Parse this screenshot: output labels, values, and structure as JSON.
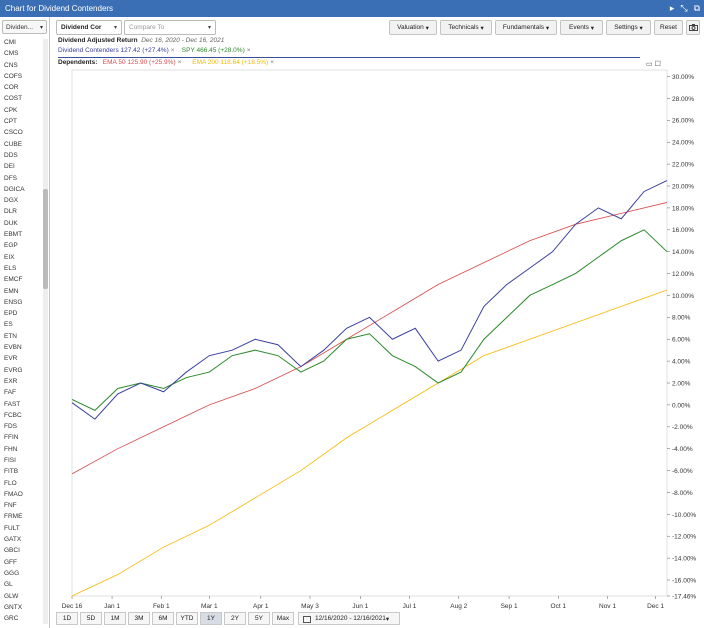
{
  "window": {
    "title": "Chart for Dividend Contenders"
  },
  "sidebar": {
    "select_label": "Dividen...",
    "items": [
      "CMI",
      "CMS",
      "CNS",
      "COFS",
      "COR",
      "COST",
      "CPK",
      "CPT",
      "CSCO",
      "CUBE",
      "DDS",
      "DEI",
      "DFS",
      "DGICA",
      "DGX",
      "DLR",
      "DUK",
      "EBMT",
      "EGP",
      "EIX",
      "ELS",
      "EMCF",
      "EMN",
      "ENSG",
      "EPD",
      "ES",
      "ETN",
      "EVBN",
      "EVR",
      "EVRG",
      "EXR",
      "FAF",
      "FAST",
      "FCBC",
      "FDS",
      "FFIN",
      "FHN",
      "FISI",
      "FITB",
      "FLO",
      "FMAO",
      "FNF",
      "FRME",
      "FULT",
      "GATX",
      "GBCI",
      "GFF",
      "GGG",
      "GL",
      "GLW",
      "GNTX",
      "GRC"
    ]
  },
  "toolbar": {
    "symbol": "Dividend Cor",
    "compare_placeholder": "Compare To",
    "valuation": "Valuation",
    "technicals": "Technicals",
    "fundamentals": "Fundamentals",
    "events": "Events",
    "settings": "Settings",
    "reset": "Reset"
  },
  "info": {
    "heading": "Dividend Adjusted Return",
    "range": "Dec 16, 2020 - Dec 16, 2021",
    "series1": "Dividend Contenders 127.42 (+27.4%)",
    "series2": "SPY 466.45 (+28.0%)",
    "dependents_label": "Dependents:",
    "dep1": "EMA 50 125.90 (+25.9%)",
    "dep2": "EMA 200 118.64 (+18.5%)",
    "close_mark": "×"
  },
  "bottom": {
    "ranges": [
      "1D",
      "5D",
      "1M",
      "3M",
      "6M",
      "YTD",
      "1Y",
      "2Y",
      "5Y",
      "Max"
    ],
    "active": "1Y",
    "date_range": "12/16/2020 - 12/16/2021"
  },
  "colors": {
    "contenders": "#3a3f9e",
    "spy": "#2a8a2a",
    "ema50": "#d84a4a",
    "ema200": "#f5b800",
    "titlebar": "#3a6fb5"
  },
  "chart_data": {
    "type": "line",
    "x_labels": [
      "Dec 16",
      "Jan 1",
      "Feb 1",
      "Mar 1",
      "Apr 1",
      "May 3",
      "Jun 1",
      "Jul 1",
      "Aug 2",
      "Sep 1",
      "Oct 1",
      "Nov 1",
      "Dec 1"
    ],
    "y_ticks": [
      "30.00%",
      "28.00%",
      "26.00%",
      "24.00%",
      "22.00%",
      "20.00%",
      "18.00%",
      "16.00%",
      "14.00%",
      "12.00%",
      "10.00%",
      "8.00%",
      "6.00%",
      "4.00%",
      "2.00%",
      "0.00%",
      "-2.00%",
      "-4.00%",
      "-6.00%",
      "-8.00%",
      "-10.00%",
      "-12.00%",
      "-14.00%",
      "-16.00%",
      "-17.46%"
    ],
    "ylim": [
      -17.46,
      30.6
    ],
    "series": [
      {
        "name": "Dividend Contenders",
        "x": [
          0,
          2,
          4,
          6,
          8,
          10,
          12,
          14,
          16,
          18,
          20,
          22,
          24,
          26,
          28,
          30,
          32,
          34,
          36,
          38,
          40,
          42,
          44,
          46,
          48,
          50,
          52
        ],
        "values": [
          0.2,
          -1.3,
          1,
          2,
          1.2,
          3,
          4.5,
          5,
          6,
          5.5,
          3.5,
          5,
          7,
          8,
          6,
          7,
          4,
          5,
          9,
          11,
          12.5,
          14,
          16.5,
          18,
          17,
          19.5,
          20.5
        ]
      },
      {
        "name": "SPY",
        "x": [
          0,
          2,
          4,
          6,
          8,
          10,
          12,
          14,
          16,
          18,
          20,
          22,
          24,
          26,
          28,
          30,
          32,
          34,
          36,
          38,
          40,
          42,
          44,
          46,
          48,
          50,
          52
        ],
        "values": [
          0.5,
          -0.5,
          1.5,
          2,
          1.5,
          2.5,
          3,
          4.5,
          5,
          4.5,
          3,
          4,
          6,
          6.5,
          4.5,
          3.5,
          2,
          3,
          6,
          8,
          10,
          11,
          12,
          13.5,
          15,
          16,
          14
        ]
      },
      {
        "name": "EMA 50",
        "x": [
          0,
          4,
          8,
          12,
          16,
          20,
          24,
          28,
          32,
          36,
          40,
          44,
          48,
          52
        ],
        "values": [
          -6.3,
          -4,
          -2,
          0,
          1.5,
          3.5,
          6,
          8.5,
          11,
          13,
          15,
          16.5,
          17.5,
          18.5
        ]
      },
      {
        "name": "EMA 200",
        "x": [
          0,
          4,
          8,
          12,
          16,
          20,
          24,
          28,
          32,
          36,
          40,
          44,
          48,
          52
        ],
        "values": [
          -17.46,
          -15.5,
          -13,
          -11,
          -8.5,
          -6,
          -3,
          -0.5,
          2,
          4.5,
          6,
          7.5,
          9,
          10.5
        ]
      }
    ]
  }
}
